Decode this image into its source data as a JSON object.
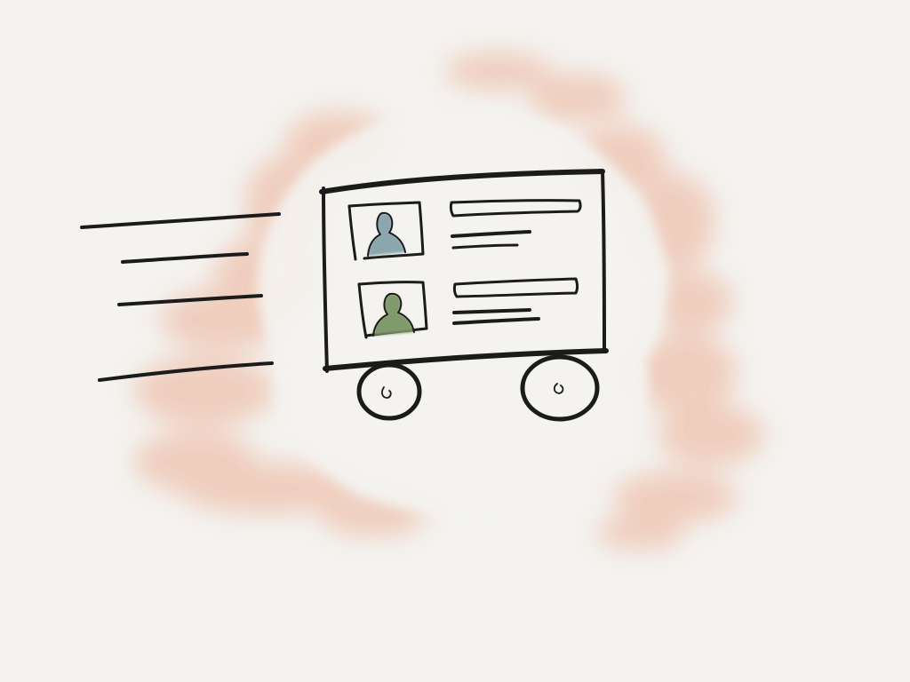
{
  "sketch": {
    "subject": "profile-card-cart",
    "colors": {
      "paper": "#f4f3f0",
      "wash": "#eaa486",
      "ink": "#1b1b1b",
      "avatar_top": "#7f9ea6",
      "avatar_bottom": "#7b9664"
    },
    "speed_lines": 4,
    "profiles": [
      {
        "avatar": "person-icon"
      },
      {
        "avatar": "person-icon"
      }
    ]
  }
}
